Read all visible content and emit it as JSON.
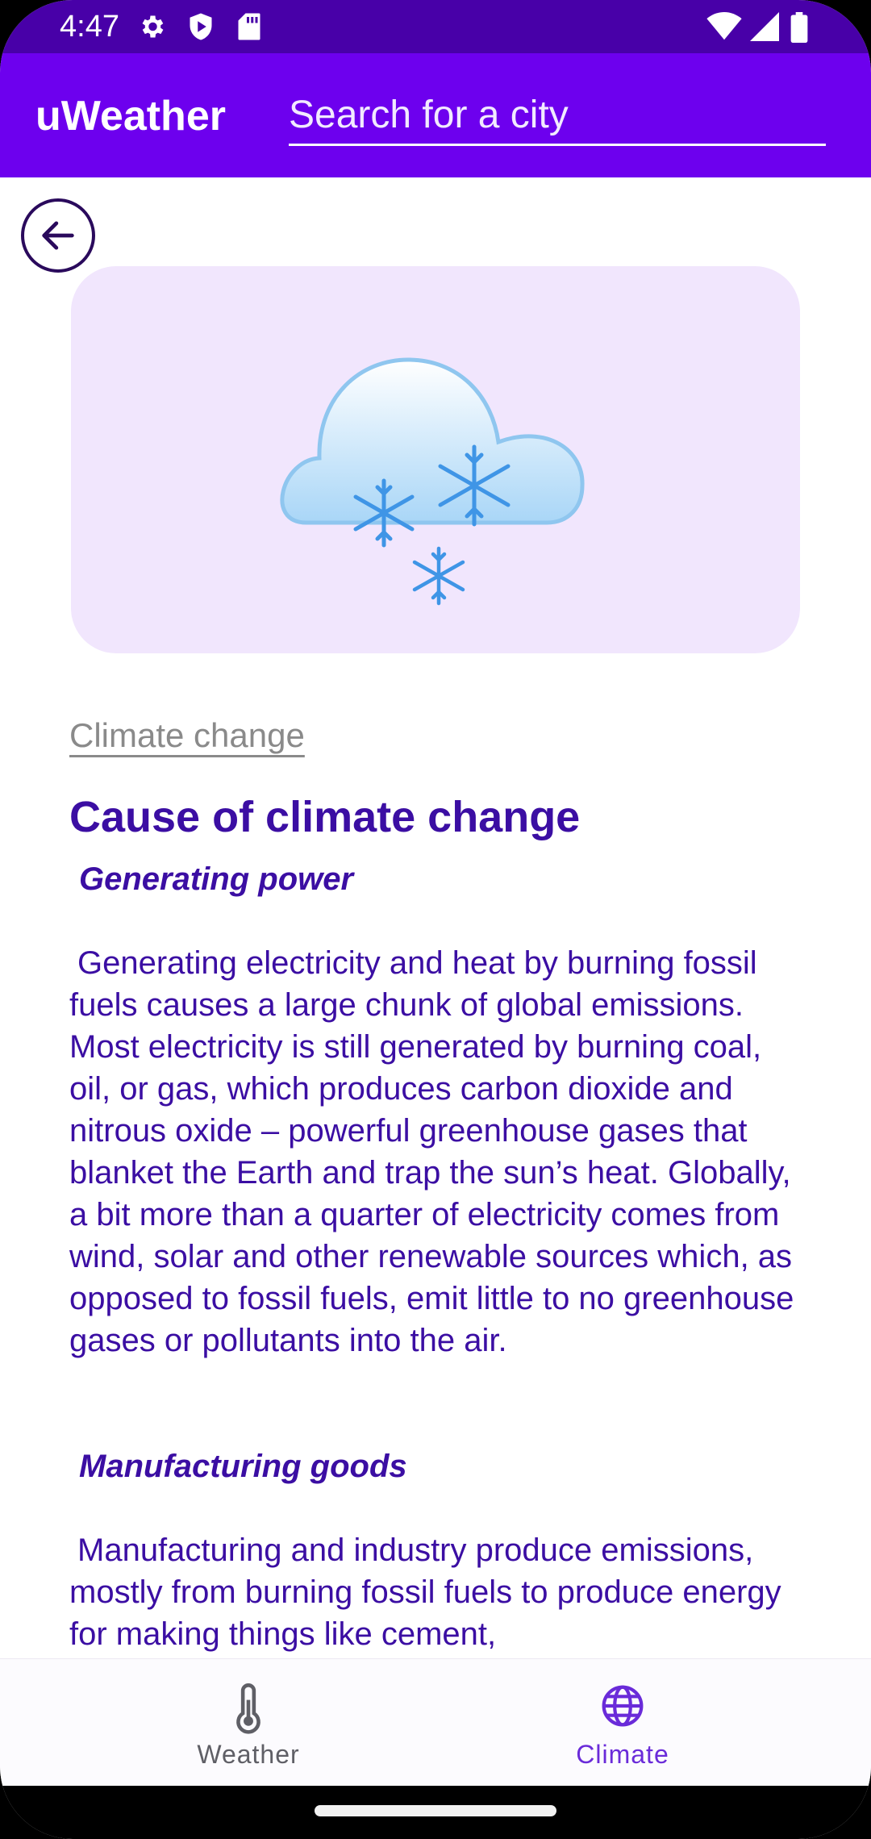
{
  "status_bar": {
    "time": "4:47",
    "icons_left": [
      "gear-icon",
      "play-protect-icon",
      "sd-card-icon"
    ],
    "icons_right": [
      "wifi-icon",
      "cell-signal-icon",
      "battery-icon"
    ]
  },
  "app_bar": {
    "title": "uWeather",
    "search_placeholder": "Search for a city"
  },
  "content": {
    "back_icon": "arrow-left-icon",
    "hero_icon": "snow-cloud-icon",
    "topic_link": "Climate change",
    "section_title": "Cause of climate change",
    "sections": [
      {
        "heading": "Generating power",
        "body": "Generating electricity and heat by burning fossil fuels causes a large chunk of global emissions. Most electricity is still generated by burning coal, oil, or gas, which produces carbon dioxide and nitrous oxide – powerful greenhouse gases that blanket the Earth and trap the sun’s heat. Globally, a bit more than a quarter of electricity comes from wind, solar and other renewable sources which, as opposed to fossil fuels, emit little to no greenhouse gases or pollutants into the air."
      },
      {
        "heading": "Manufacturing goods",
        "body": "Manufacturing and industry produce emissions, mostly from burning fossil fuels to produce energy for making things like cement,"
      }
    ]
  },
  "bottom_nav": {
    "items": [
      {
        "label": "Weather",
        "icon": "thermometer-icon",
        "active": false
      },
      {
        "label": "Climate",
        "icon": "globe-icon",
        "active": true
      }
    ],
    "active_color": "#6a2bd9",
    "inactive_color": "#5f5f66"
  },
  "colors": {
    "status_bar": "#4800a8",
    "app_bar": "#6d00ee",
    "accent_text": "#3b0ea3",
    "card_bg": "#f1e6fd"
  }
}
